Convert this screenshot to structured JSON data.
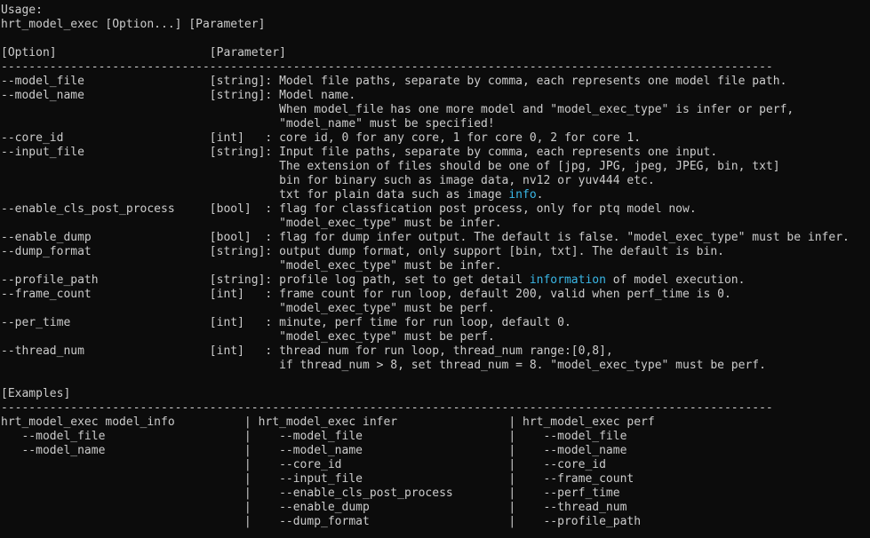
{
  "terminal": {
    "lines": [
      [
        {
          "t": "Usage:"
        }
      ],
      [
        {
          "t": "hrt_model_exec [Option...] [Parameter]"
        }
      ],
      [
        {
          "t": ""
        }
      ],
      [
        {
          "t": "[Option]                      [Parameter]"
        }
      ],
      [
        {
          "t": "---------------------------------------------------------------------------------------------------------------"
        }
      ],
      [
        {
          "t": "--model_file                  [string]: Model file paths, separate by comma, each represents one model file path."
        }
      ],
      [
        {
          "t": "--model_name                  [string]: Model name."
        }
      ],
      [
        {
          "t": "                                        When model_file has one more model and \"model_exec_type\" is infer or perf,"
        }
      ],
      [
        {
          "t": "                                        \"model_name\" must be specified!"
        }
      ],
      [
        {
          "t": "--core_id                     [int]   : core id, 0 for any core, 1 for core 0, 2 for core 1."
        }
      ],
      [
        {
          "t": "--input_file                  [string]: Input file paths, separate by comma, each represents one input."
        }
      ],
      [
        {
          "t": "                                        The extension of files should be one of [jpg, JPG, jpeg, JPEG, bin, txt]"
        }
      ],
      [
        {
          "t": "                                        bin for binary such as image data, nv12 or yuv444 etc."
        }
      ],
      [
        {
          "t": "                                        txt for plain data such as image "
        },
        {
          "t": "info",
          "hl": true
        },
        {
          "t": "."
        }
      ],
      [
        {
          "t": "--enable_cls_post_process     [bool]  : flag for classfication post process, only for ptq model now."
        }
      ],
      [
        {
          "t": "                                        \"model_exec_type\" must be infer."
        }
      ],
      [
        {
          "t": "--enable_dump                 [bool]  : flag for dump infer output. The default is false. \"model_exec_type\" must be infer."
        }
      ],
      [
        {
          "t": "--dump_format                 [string]: output dump format, only support [bin, txt]. The default is bin."
        }
      ],
      [
        {
          "t": "                                        \"model_exec_type\" must be infer."
        }
      ],
      [
        {
          "t": "--profile_path                [string]: profile log path, set to get detail "
        },
        {
          "t": "information",
          "hl": true
        },
        {
          "t": " of model execution."
        }
      ],
      [
        {
          "t": "--frame_count                 [int]   : frame count for run loop, default 200, valid when perf_time is 0."
        }
      ],
      [
        {
          "t": "                                        \"model_exec_type\" must be perf."
        }
      ],
      [
        {
          "t": "--per_time                    [int]   : minute, perf time for run loop, default 0."
        }
      ],
      [
        {
          "t": "                                        \"model_exec_type\" must be perf."
        }
      ],
      [
        {
          "t": "--thread_num                  [int]   : thread num for run loop, thread_num range:[0,8],"
        }
      ],
      [
        {
          "t": "                                        if thread_num > 8, set thread_num = 8. \"model_exec_type\" must be perf."
        }
      ],
      [
        {
          "t": ""
        }
      ],
      [
        {
          "t": "[Examples]"
        }
      ],
      [
        {
          "t": "---------------------------------------------------------------------------------------------------------------"
        }
      ],
      [
        {
          "t": "hrt_model_exec model_info          | hrt_model_exec infer                | hrt_model_exec perf"
        }
      ],
      [
        {
          "t": "   --model_file                    |    --model_file                     |    --model_file"
        }
      ],
      [
        {
          "t": "   --model_name                    |    --model_name                     |    --model_name"
        }
      ],
      [
        {
          "t": "                                   |    --core_id                        |    --core_id"
        }
      ],
      [
        {
          "t": "                                   |    --input_file                     |    --frame_count"
        }
      ],
      [
        {
          "t": "                                   |    --enable_cls_post_process        |    --perf_time"
        }
      ],
      [
        {
          "t": "                                   |    --enable_dump                    |    --thread_num"
        }
      ],
      [
        {
          "t": "                                   |    --dump_format                    |    --profile_path"
        }
      ]
    ]
  }
}
